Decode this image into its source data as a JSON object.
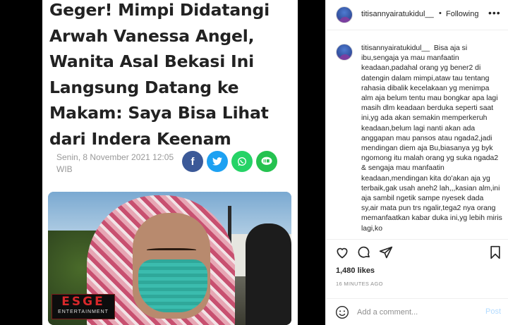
{
  "article": {
    "headline": "Geger! Mimpi Didatangi Arwah Vanessa Angel, Wanita Asal Bekasi Ini Langsung Datang ke Makam: Saya Bisa Lihat dari Indera Keenam",
    "dateline": "Senin, 8 November 2021 12:05 WIB",
    "share_icons": [
      "facebook-icon",
      "twitter-icon",
      "whatsapp-icon",
      "line-icon"
    ],
    "photo_logo_main": "ESGE",
    "photo_logo_sub": "ENTERTAINMENT",
    "share_colors": {
      "facebook": "#3b5998",
      "twitter": "#1da1f2",
      "whatsapp": "#25d366",
      "line": "#25c250"
    }
  },
  "post": {
    "username": "titisannyairatukidul__",
    "separator": "•",
    "follow_status": "Following",
    "more_label": "•••",
    "caption_user": "titisannyairatukidul__",
    "caption_text": "Bisa aja si ibu,sengaja ya mau manfaatin keadaan,padahal orang yg bener2 di datengin dalam mimpi,ataw tau tentang rahasia dibalik kecelakaan yg menimpa alm aja belum tentu mau bongkar apa lagi masih dlm keadaan berduka seperti saat ini,yg ada akan semakin memperkeruh keadaan,belum lagi nanti akan ada anggapan mau pansos atau ngada2,jadi mendingan diem aja Bu,biasanya yg byk ngomong itu malah orang yg suka ngada2 & sengaja mau manfaatin keadaan,mendingan kita do'akan aja yg terbaik,gak usah aneh2 lah,,,kasian alm,ini aja sambil ngetik sampe nyesek dada sy,air mata pun trs ngalir,tega2 nya orang memanfaatkan kabar duka ini,yg lebih miris lagi,ko",
    "likes": "1,480 likes",
    "time": "16 MINUTES AGO",
    "comment_placeholder": "Add a comment...",
    "post_label": "Post"
  }
}
